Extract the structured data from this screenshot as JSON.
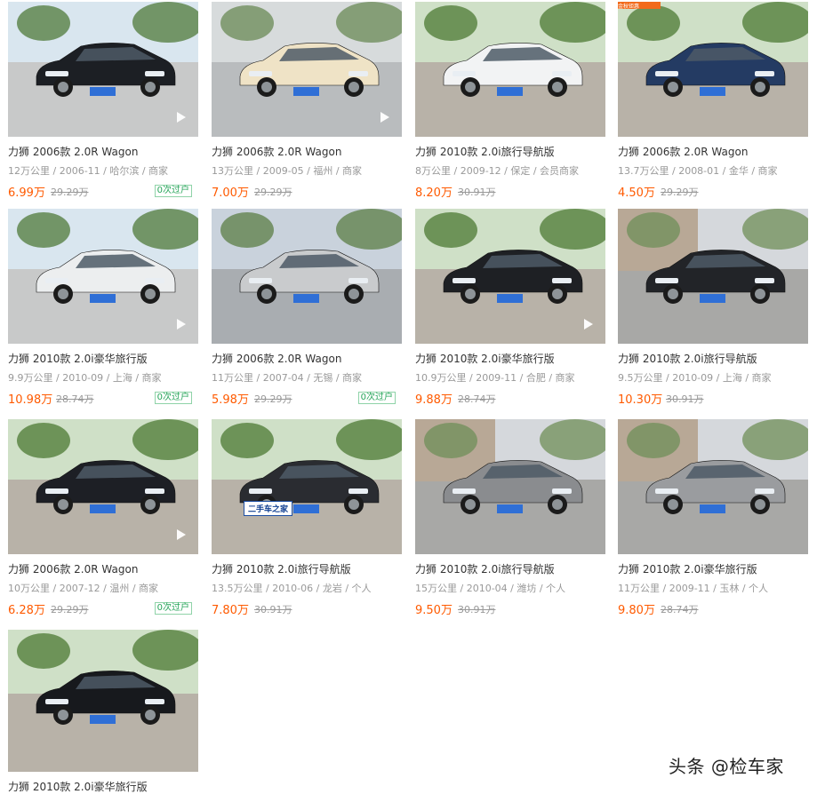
{
  "listings": [
    {
      "title": "力狮 2006款 2.0R Wagon",
      "meta": "12万公里 / 2006-11 / 哈尔滨 / 商家",
      "price": "6.99万",
      "original_price": "29.29万",
      "transfer": "0次过户",
      "photo": {
        "car_color": "#1c1f24",
        "scene": "parking",
        "has_video": true
      }
    },
    {
      "title": "力狮 2006款 2.0R Wagon",
      "meta": "13万公里 / 2009-05 / 福州 / 商家",
      "price": "7.00万",
      "original_price": "29.29万",
      "transfer": "",
      "photo": {
        "car_color": "#efe3c6",
        "scene": "street",
        "has_video": true
      }
    },
    {
      "title": "力狮 2010款 2.0i旅行导航版",
      "meta": "8万公里 / 2009-12 / 保定 / 会员商家",
      "price": "8.20万",
      "original_price": "30.91万",
      "transfer": "",
      "photo": {
        "car_color": "#f2f3f4",
        "scene": "trees",
        "has_video": false
      }
    },
    {
      "title": "力狮 2006款 2.0R Wagon",
      "meta": "13.7万公里 / 2008-01 / 金华 / 商家",
      "price": "4.50万",
      "original_price": "29.29万",
      "transfer": "",
      "photo": {
        "car_color": "#243b63",
        "scene": "trees",
        "has_video": false,
        "badge": "金秋钜惠"
      }
    },
    {
      "title": "力狮 2010款 2.0i豪华旅行版",
      "meta": "9.9万公里 / 2010-09 / 上海 / 商家",
      "price": "10.98万",
      "original_price": "28.74万",
      "transfer": "0次过户",
      "photo": {
        "car_color": "#eceeef",
        "scene": "parking",
        "has_video": true
      }
    },
    {
      "title": "力狮 2006款 2.0R Wagon",
      "meta": "11万公里 / 2007-04 / 无锡 / 商家",
      "price": "5.98万",
      "original_price": "29.29万",
      "transfer": "0次过户",
      "photo": {
        "car_color": "#c9cbcd",
        "scene": "lot",
        "has_video": false
      }
    },
    {
      "title": "力狮 2010款 2.0i豪华旅行版",
      "meta": "10.9万公里 / 2009-11 / 合肥 / 商家",
      "price": "9.88万",
      "original_price": "28.74万",
      "transfer": "",
      "photo": {
        "car_color": "#1e2024",
        "scene": "trees",
        "has_video": true
      }
    },
    {
      "title": "力狮 2010款 2.0i旅行导航版",
      "meta": "9.5万公里 / 2010-09 / 上海 / 商家",
      "price": "10.30万",
      "original_price": "30.91万",
      "transfer": "",
      "photo": {
        "car_color": "#222428",
        "scene": "building",
        "has_video": false
      }
    },
    {
      "title": "力狮 2006款 2.0R Wagon",
      "meta": "10万公里 / 2007-12 / 温州 / 商家",
      "price": "6.28万",
      "original_price": "29.29万",
      "transfer": "0次过户",
      "photo": {
        "car_color": "#1d1f25",
        "scene": "trees",
        "has_video": true
      }
    },
    {
      "title": "力狮 2010款 2.0i旅行导航版",
      "meta": "13.5万公里 / 2010-06 / 龙岩 / 个人",
      "price": "7.80万",
      "original_price": "30.91万",
      "transfer": "",
      "photo": {
        "car_color": "#2a2c31",
        "scene": "trees",
        "has_video": false,
        "watermark": "二手车之家"
      }
    },
    {
      "title": "力狮 2010款 2.0i旅行导航版",
      "meta": "15万公里 / 2010-04 / 潍坊 / 个人",
      "price": "9.50万",
      "original_price": "30.91万",
      "transfer": "",
      "photo": {
        "car_color": "#8a8c8f",
        "scene": "building",
        "has_video": false
      }
    },
    {
      "title": "力狮 2010款 2.0i豪华旅行版",
      "meta": "11万公里 / 2009-11 / 玉林 / 个人",
      "price": "9.80万",
      "original_price": "28.74万",
      "transfer": "",
      "photo": {
        "car_color": "#9a9c9f",
        "scene": "building",
        "has_video": false
      }
    },
    {
      "title": "力狮 2010款 2.0i豪华旅行版",
      "meta": "",
      "price": "",
      "original_price": "",
      "transfer": "",
      "photo": {
        "car_color": "#17191d",
        "scene": "trees",
        "has_video": false
      }
    }
  ],
  "watermark_brand": "头条 @检车家",
  "watermark_label": "二手车之家",
  "colors": {
    "price": "#ff5a00",
    "transfer": "#27a55a",
    "title": "#333333",
    "meta": "#999999"
  }
}
